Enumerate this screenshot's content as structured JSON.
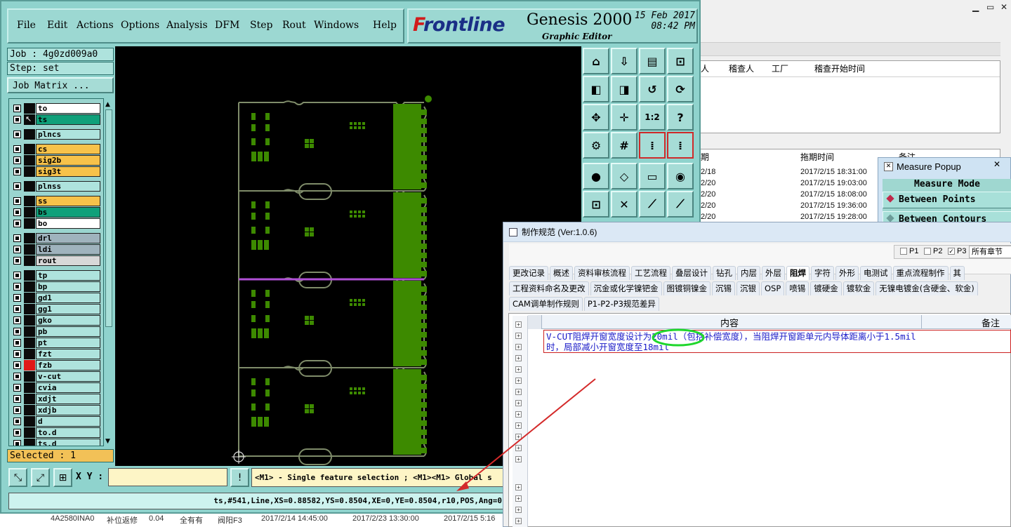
{
  "bg_window": {
    "controls": [
      "▁",
      "▭",
      "✕"
    ],
    "table1_headers": [
      "人",
      "稽查人",
      "工厂",
      "稽查开始时间"
    ],
    "table2_headers": [
      "期",
      "拖期时间",
      "备注"
    ],
    "table2_rows": [
      {
        "date": "2/18",
        "time": "2017/2/15 18:31:00"
      },
      {
        "date": "2/20",
        "time": "2017/2/15 19:03:00"
      },
      {
        "date": "2/20",
        "time": "2017/2/15 18:08:00"
      },
      {
        "date": "2/20",
        "time": "2017/2/15 19:36:00"
      },
      {
        "date": "2/20",
        "time": "2017/2/15 19:28:00"
      }
    ]
  },
  "bg_strip": {
    "items": [
      "4A2580INA0",
      "补位返修",
      "0.04",
      "全有有",
      "阀阳F3",
      "2017/2/14 14:45:00",
      "2017/2/23 13:30:00",
      "2017/2/15 5:16"
    ]
  },
  "menu": {
    "items": [
      "File",
      "Edit",
      "Actions",
      "Options",
      "Analysis",
      "DFM",
      "Step",
      "Rout",
      "Windows",
      "Help"
    ]
  },
  "brand": {
    "logo_prefix": "F",
    "logo_rest": "rontline",
    "product": "Genesis 2000",
    "subtitle": "Graphic Editor",
    "date": "15 Feb 2017",
    "time": "08:42 PM"
  },
  "job": {
    "job_line": "Job : 4g0zd009a0",
    "step_line": "Step: set",
    "matrix_button": "Job Matrix ...",
    "selected": "Selected : 1"
  },
  "layers": [
    {
      "name": "to",
      "color": "#ffffff",
      "swatch": "#0b0b0b"
    },
    {
      "name": "ts",
      "color": "#0fa07a",
      "swatch": "#0b0b0b",
      "active": true
    },
    {
      "name": "plncs",
      "color": "#aee3dd",
      "swatch": "#0b0b0b"
    },
    {
      "name": "cs",
      "color": "#f7c24a",
      "swatch": "#0b0b0b"
    },
    {
      "name": "sig2b",
      "color": "#f7c24a",
      "swatch": "#0b0b0b"
    },
    {
      "name": "sig3t",
      "color": "#f7c24a",
      "swatch": "#0b0b0b"
    },
    {
      "name": "plnss",
      "color": "#aee3dd",
      "swatch": "#0b0b0b"
    },
    {
      "name": "ss",
      "color": "#f7c24a",
      "swatch": "#0b0b0b"
    },
    {
      "name": "bs",
      "color": "#0fa07a",
      "swatch": "#0b0b0b"
    },
    {
      "name": "bo",
      "color": "#ffffff",
      "swatch": "#0b0b0b"
    },
    {
      "name": "drl",
      "color": "#9fb3bd",
      "swatch": "#0b0b0b"
    },
    {
      "name": "ldi",
      "color": "#9fb3bd",
      "swatch": "#0b0b0b"
    },
    {
      "name": "rout",
      "color": "#d8d8d8",
      "swatch": "#0b0b0b"
    },
    {
      "name": "tp",
      "color": "#aee3dd",
      "swatch": "#0b0b0b"
    },
    {
      "name": "bp",
      "color": "#aee3dd",
      "swatch": "#0b0b0b"
    },
    {
      "name": "gd1",
      "color": "#aee3dd",
      "swatch": "#0b0b0b"
    },
    {
      "name": "gg1",
      "color": "#aee3dd",
      "swatch": "#0b0b0b"
    },
    {
      "name": "gko",
      "color": "#aee3dd",
      "swatch": "#0b0b0b"
    },
    {
      "name": "pb",
      "color": "#aee3dd",
      "swatch": "#0b0b0b"
    },
    {
      "name": "pt",
      "color": "#aee3dd",
      "swatch": "#0b0b0b"
    },
    {
      "name": "fzt",
      "color": "#aee3dd",
      "swatch": "#0b0b0b"
    },
    {
      "name": "fzb",
      "color": "#aee3dd",
      "swatch": "#e01818"
    },
    {
      "name": "v-cut",
      "color": "#aee3dd",
      "swatch": "#0b0b0b"
    },
    {
      "name": "cvia",
      "color": "#aee3dd",
      "swatch": "#0b0b0b"
    },
    {
      "name": "xdjt",
      "color": "#aee3dd",
      "swatch": "#0b0b0b"
    },
    {
      "name": "xdjb",
      "color": "#aee3dd",
      "swatch": "#0b0b0b"
    },
    {
      "name": "d",
      "color": "#aee3dd",
      "swatch": "#0b0b0b"
    },
    {
      "name": "to.d",
      "color": "#aee3dd",
      "swatch": "#0b0b0b"
    },
    {
      "name": "ts.d",
      "color": "#aee3dd",
      "swatch": "#0b0b0b"
    }
  ],
  "toolbox": {
    "buttons": [
      {
        "icon": "zoom-home-icon",
        "glyph": "⌂"
      },
      {
        "icon": "zoom-down-icon",
        "glyph": "⇩"
      },
      {
        "icon": "zoom-page-icon",
        "glyph": "▤"
      },
      {
        "icon": "zoom-window-icon",
        "glyph": "⊡"
      },
      {
        "icon": "pan-left-icon",
        "glyph": "◧"
      },
      {
        "icon": "pan-right-icon",
        "glyph": "◨"
      },
      {
        "icon": "undo-icon",
        "glyph": "↺"
      },
      {
        "icon": "redraw-icon",
        "glyph": "⟳"
      },
      {
        "icon": "fit-all-icon",
        "glyph": "✥"
      },
      {
        "icon": "center-icon",
        "glyph": "✛"
      },
      {
        "icon": "scale-icon",
        "glyph": "1:2"
      },
      {
        "icon": "help-icon",
        "glyph": "?"
      },
      {
        "icon": "snap-icon",
        "glyph": "⚙"
      },
      {
        "icon": "grid-icon",
        "glyph": "#"
      },
      {
        "icon": "layer-compare-icon",
        "glyph": "⁞"
      },
      {
        "icon": "layer-compare-all-icon",
        "glyph": "⁞"
      },
      {
        "icon": "measure-icon",
        "glyph": "●"
      },
      {
        "icon": "polygon-icon",
        "glyph": "◇"
      },
      {
        "icon": "ruler-icon",
        "glyph": "▭"
      },
      {
        "icon": "circle-icon",
        "glyph": "◉"
      },
      {
        "icon": "connect-icon",
        "glyph": "⊡"
      },
      {
        "icon": "cross-icon",
        "glyph": "✕"
      },
      {
        "icon": "line-red-icon",
        "glyph": "⟋"
      },
      {
        "icon": "line-blue-icon",
        "glyph": "⟋"
      }
    ]
  },
  "bottom": {
    "xy_label": "X Y :",
    "xy_value": "",
    "message": "<M1> - Single feature selection ; <M1><M1> Global s",
    "status": "ts,#541,Line,XS=0.88582,YS=0.8504,XE=0,YE=0.8504,r10,POS,Ang=0"
  },
  "measure_popup": {
    "title": "Measure Popup",
    "mode_header": "Measure Mode",
    "options": [
      "Between Points",
      "Between Contours"
    ]
  },
  "spec_window": {
    "title": "制作规范 (Ver:1.0.6)",
    "toggles": [
      "P1",
      "P2",
      "P3"
    ],
    "chapter_select": "所有章节",
    "tabs_row1": [
      "更改记录",
      "概述",
      "资料审核流程",
      "工艺流程",
      "叠层设计",
      "钻孔",
      "内层",
      "外层",
      "阻焊",
      "字符",
      "外形",
      "电测试",
      "重点流程制作",
      "其"
    ],
    "tabs_row2": [
      "工程资料命名及更改",
      "沉金或化学镍钯金",
      "图镀铜镍金",
      "沉锡",
      "沉银",
      "OSP",
      "喷锡",
      "镀硬金",
      "镀软金",
      "无镍电镀金(含硬金、软金)"
    ],
    "tabs_row3": [
      "CAM调单制作规则",
      "P1-P2-P3规范差异"
    ],
    "active_tab": "阻焊",
    "grid_headers": {
      "content": "内容",
      "note": "备注"
    },
    "row1_text": "V-CUT阻焊开窗宽度设计为20mil（包括补偿宽度），当阻焊开窗距单元内导体距离小于1.5mil时，局部减小开窗宽度至18mil"
  },
  "colors": {
    "genesis_bg": "#8fd3cd",
    "canvas": "#000000",
    "pcb_green": "#3d8a00",
    "outline": "#7f8c6a",
    "highlight_line": "#b04fd6",
    "annotation_red": "#d42a2a",
    "annotation_green": "#1fd72c"
  }
}
